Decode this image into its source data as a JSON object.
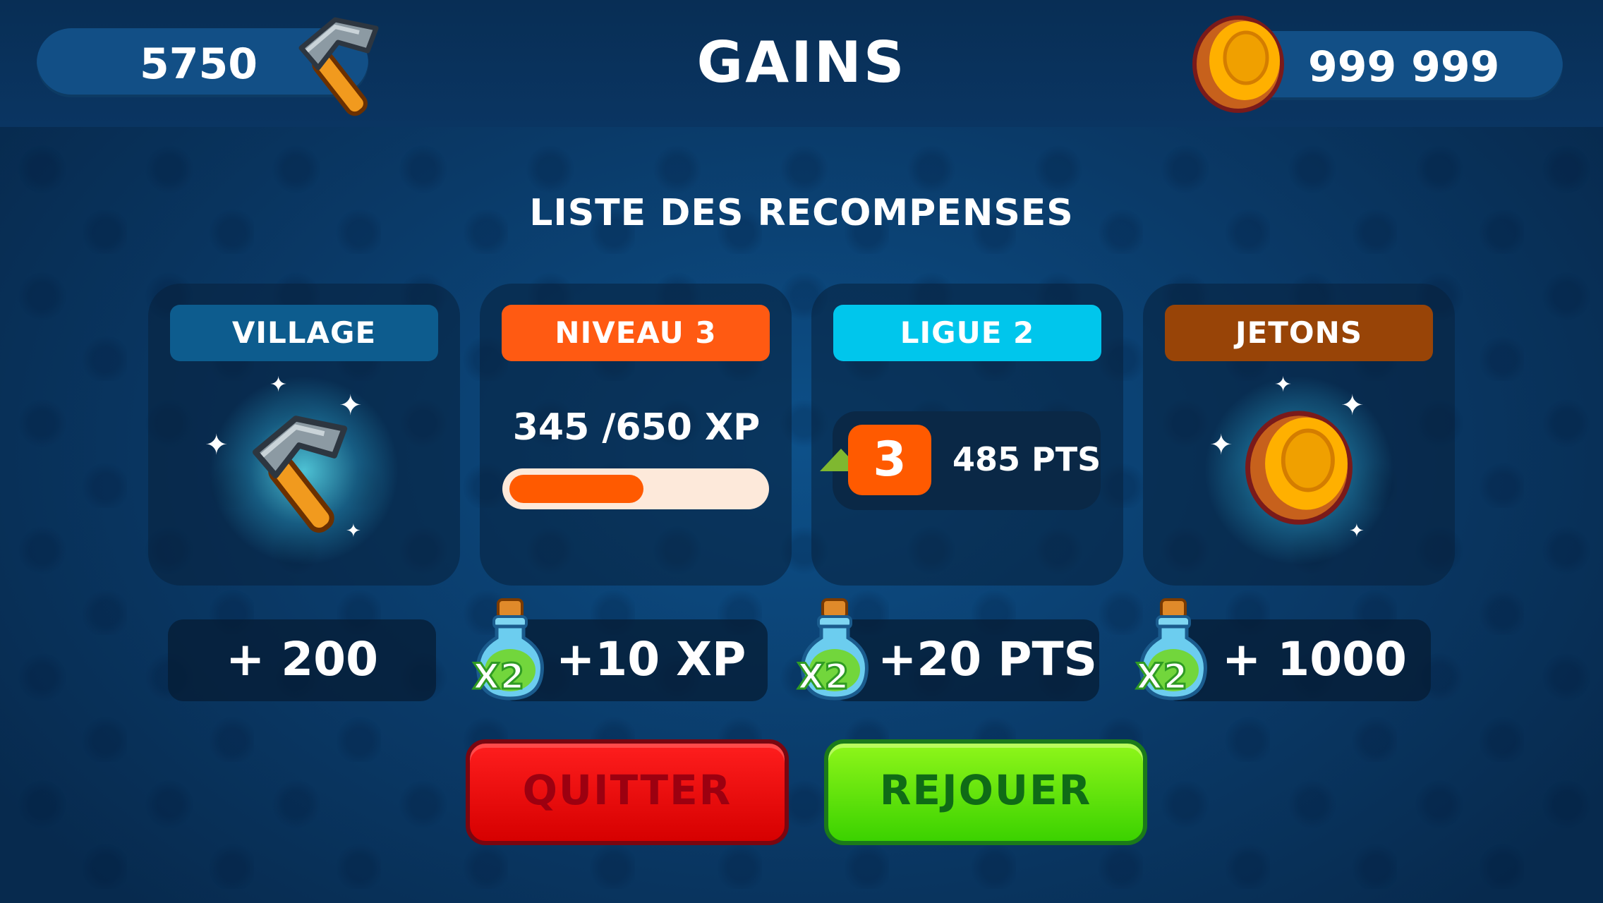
{
  "header": {
    "hammer_count": "5750",
    "title": "GAINS",
    "coin_count": "999 999"
  },
  "subtitle": "LISTE DES RECOMPENSES",
  "cards": {
    "village": {
      "label": "VILLAGE",
      "color": "#0d5c8e"
    },
    "level": {
      "label": "NIVEAU 3",
      "color": "#ff5a12",
      "xp_text": "345 /650 XP",
      "progress": 0.53
    },
    "league": {
      "label": "LIGUE 2",
      "color": "#00c6ec",
      "rank": "3",
      "points": "485 PTS"
    },
    "tokens": {
      "label": "JETONS",
      "color": "#984407"
    }
  },
  "rewards": {
    "village": "+ 200",
    "level": "+10 XP",
    "league": "+20 PTS",
    "tokens": "+ 1000",
    "multiplier": "X2"
  },
  "buttons": {
    "quit": "QUITTER",
    "replay": "REJOUER"
  },
  "icons": [
    "hammer-icon",
    "coin-icon",
    "potion-icon",
    "sparkle-icon",
    "rank-up-arrow-icon"
  ]
}
